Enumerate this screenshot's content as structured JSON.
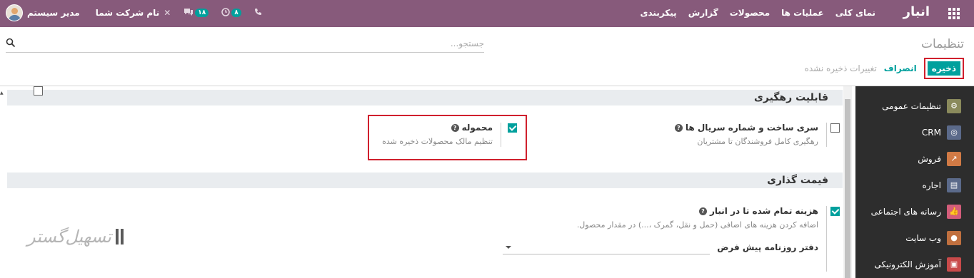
{
  "navbar": {
    "brand": "انبار",
    "menu": [
      "نمای کلی",
      "عملیات ها",
      "محصولات",
      "گزارش",
      "پیکربندی"
    ],
    "user_name": "مدیر سیستم",
    "company": "نام شرکت شما",
    "messages_count": "۱۸",
    "activities_count": "۸"
  },
  "control_panel": {
    "title": "تنظیمات",
    "search_placeholder": "جستجو...",
    "save_label": "ذخیره",
    "discard_label": "انصراف",
    "unsaved_label": "تغییرات ذخیره نشده"
  },
  "sidebar": {
    "items": [
      {
        "label": "تنظیمات عمومی",
        "icon": "gear-icon",
        "color": "#8a8a5c"
      },
      {
        "label": "CRM",
        "icon": "crm-icon",
        "color": "#5b6a8a"
      },
      {
        "label": "فروش",
        "icon": "chart-icon",
        "color": "#d17a45"
      },
      {
        "label": "اجاره",
        "icon": "rental-icon",
        "color": "#5b6a8a"
      },
      {
        "label": "رسانه های اجتماعی",
        "icon": "thumbs-up-icon",
        "color": "#d35d7a"
      },
      {
        "label": "وب سایت",
        "icon": "globe-icon",
        "color": "#c0703f"
      },
      {
        "label": "آموزش الکترونیکی",
        "icon": "elearning-icon",
        "color": "#c94a4a"
      }
    ]
  },
  "sections": {
    "traceability": {
      "title": "قابلیت رهگیری",
      "lots": {
        "title": "سری ساخت و شماره سریال ها",
        "desc": "رهگیری کامل فروشندگان تا مشتریان",
        "checked": false
      },
      "consignment": {
        "title": "محموله",
        "desc": "تنظیم مالک محصولات ذخیره شده",
        "checked": true
      }
    },
    "valuation": {
      "title": "قیمت گذاری",
      "landed": {
        "title": "هزینه تمام شده تا در انبار",
        "desc": "اضافه کردن هزینه های اضافی (حمل و نقل، گمرک ،...) در مقدار محصول.",
        "checked": true
      },
      "journal_label": "دفتر روزنامه پیش فرض"
    }
  },
  "watermark": {
    "text": "تسهیل‌گستر"
  },
  "colors": {
    "primary": "#875a7b",
    "accent": "#00a09d",
    "highlight": "#d0202d"
  }
}
